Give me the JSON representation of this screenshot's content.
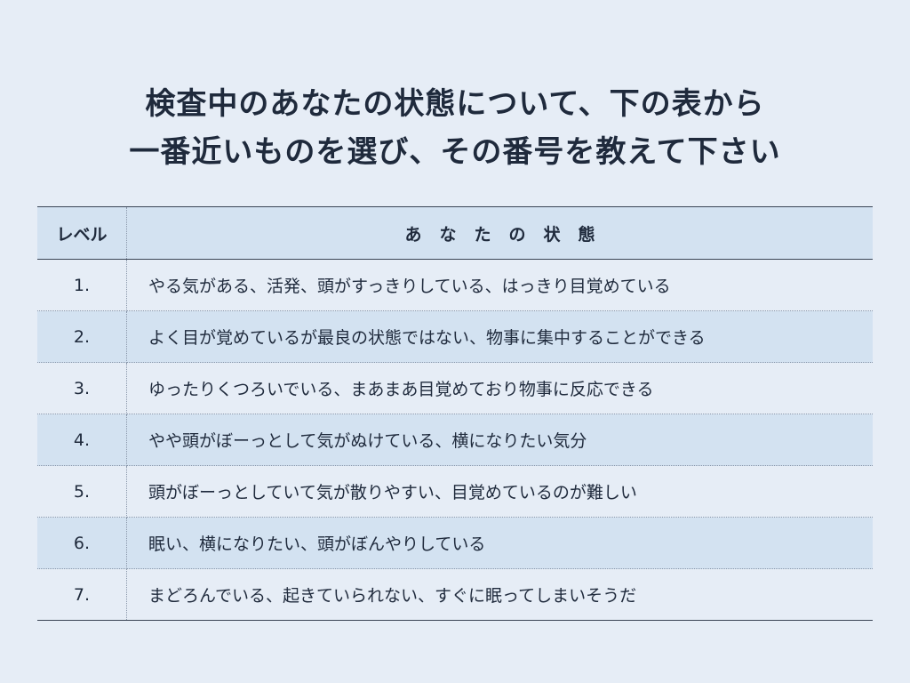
{
  "title": {
    "line1": "検査中のあなたの状態について、下の表から",
    "line2": "一番近いものを選び、その番号を教えて下さい"
  },
  "table": {
    "headers": {
      "level": "レベル",
      "state": "あなたの状態"
    },
    "rows": [
      {
        "level": "1.",
        "state": "やる気がある、活発、頭がすっきりしている、はっきり目覚めている"
      },
      {
        "level": "2.",
        "state": "よく目が覚めているが最良の状態ではない、物事に集中することができる"
      },
      {
        "level": "3.",
        "state": "ゆったりくつろいでいる、まあまあ目覚めており物事に反応できる"
      },
      {
        "level": "4.",
        "state": "やや頭がぼーっとして気がぬけている、横になりたい気分"
      },
      {
        "level": "5.",
        "state": "頭がぼーっとしていて気が散りやすい、目覚めているのが難しい"
      },
      {
        "level": "6.",
        "state": "眠い、横になりたい、頭がぼんやりしている"
      },
      {
        "level": "7.",
        "state": "まどろんでいる、起きていられない、すぐに眠ってしまいそうだ"
      }
    ]
  }
}
